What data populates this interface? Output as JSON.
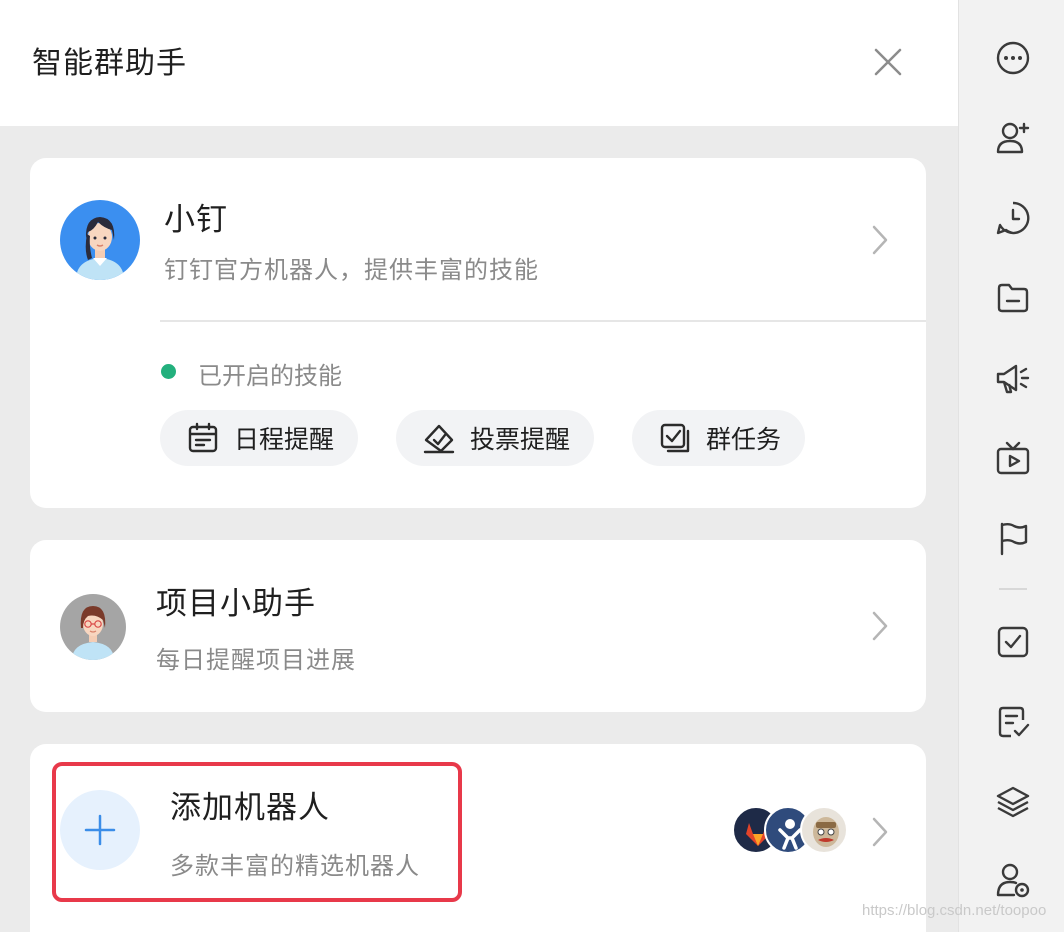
{
  "header": {
    "title": "智能群助手"
  },
  "xiaoding": {
    "name": "小钉",
    "desc": "钉钉官方机器人，提供丰富的技能",
    "enabled_label": "已开启的技能",
    "skills": [
      {
        "label": "日程提醒",
        "icon": "calendar-icon"
      },
      {
        "label": "投票提醒",
        "icon": "vote-icon"
      },
      {
        "label": "群任务",
        "icon": "task-check-icon"
      }
    ]
  },
  "project_helper": {
    "name": "项目小助手",
    "desc": "每日提醒项目进展"
  },
  "add_robot": {
    "name": "添加机器人",
    "desc": "多款丰富的精选机器人",
    "icon": "plus-icon",
    "robot_avatars": [
      "gitlab-icon",
      "jenkins-icon",
      "travis-icon"
    ]
  },
  "sidebar": {
    "icons": [
      "more-icon",
      "add-user-icon",
      "clock-icon",
      "folder-icon",
      "megaphone-icon",
      "tv-play-icon",
      "flag-icon",
      "checkbox-icon",
      "edit-check-icon",
      "layers-icon",
      "user-settings-icon"
    ]
  },
  "watermark": "https://blog.csdn.net/toopoo",
  "colors": {
    "accent": "#3a8de8",
    "status_green": "#23b07d",
    "highlight_red": "#e8394a"
  }
}
